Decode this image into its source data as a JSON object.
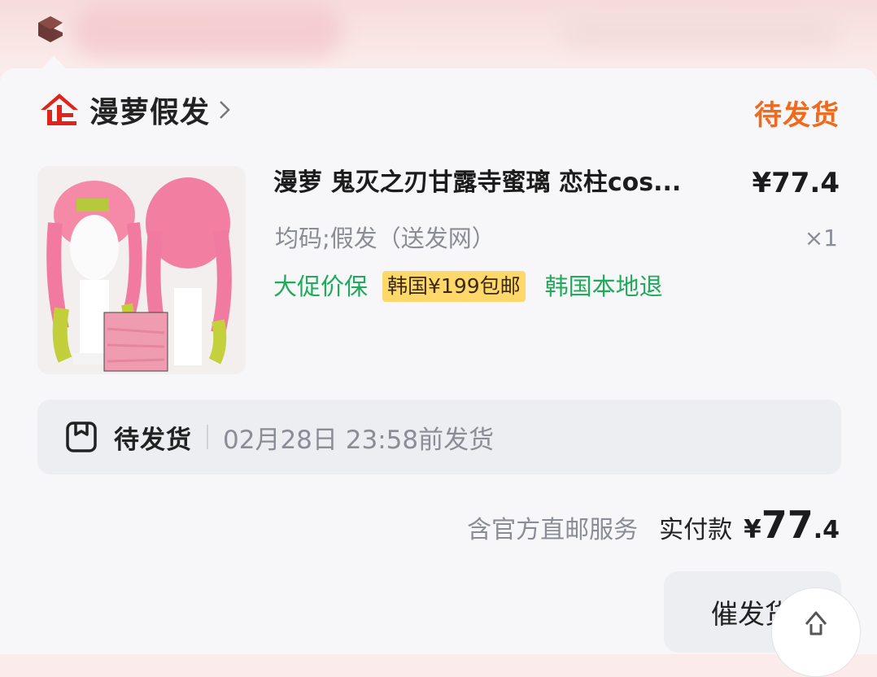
{
  "shop": {
    "name": "漫萝假发",
    "status": "待发货"
  },
  "item": {
    "title": "漫萝 鬼灭之刃甘露寺蜜璃 恋柱cos...",
    "price": "¥77.4",
    "sku": "均码;假发（送发网）",
    "qty": "×1",
    "tags": {
      "price_protect": "大促价保",
      "promo": "韩国¥199包邮",
      "return": "韩国本地退"
    }
  },
  "shipping": {
    "label": "待发货",
    "deadline": "02月28日 23:58前发货"
  },
  "summary": {
    "service": "含官方直邮服务",
    "paid_label": "实付款",
    "paid_symbol": "¥",
    "paid_int": "77",
    "paid_dec": ".4"
  },
  "actions": {
    "urge": "催发货"
  },
  "colors": {
    "status": "#f06a1e",
    "tag_green": "#1fab5a",
    "promo_bg": "#ffd86b",
    "shop_icon": "#e2231a"
  }
}
